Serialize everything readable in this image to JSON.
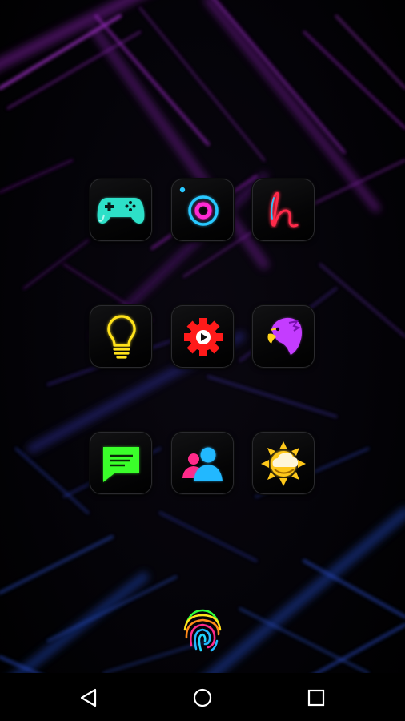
{
  "home_screen": {
    "apps": [
      {
        "name": "game-controller-app",
        "icon": "gamepad-icon",
        "color": "#2de0c8"
      },
      {
        "name": "orbit-app",
        "icon": "ring-icon",
        "color": "#28c8ff"
      },
      {
        "name": "handwriting-app",
        "icon": "letter-h-icon",
        "color": "#ff2a4a"
      },
      {
        "name": "flashlight-app",
        "icon": "lightbulb-icon",
        "color": "#ffe21a"
      },
      {
        "name": "video-settings-app",
        "icon": "gear-play-icon",
        "color": "#ff1a1a"
      },
      {
        "name": "bird-app",
        "icon": "eagle-icon",
        "color": "#c43cff"
      },
      {
        "name": "messaging-app",
        "icon": "chat-bubble-icon",
        "color": "#3aff2a"
      },
      {
        "name": "contacts-app",
        "icon": "people-icon",
        "color": "#22b8ff"
      },
      {
        "name": "weather-app",
        "icon": "sun-cloud-icon",
        "color": "#ffc81a"
      }
    ],
    "dock_app": {
      "name": "fingerprint-app",
      "icon": "fingerprint-icon"
    }
  },
  "navigation": {
    "back": "back-triangle-icon",
    "home": "home-circle-icon",
    "recents": "recents-square-icon"
  },
  "colors": {
    "wallpaper_purple": "#7a1f9e",
    "wallpaper_blue": "#1f3fa8",
    "background": "#000000"
  }
}
